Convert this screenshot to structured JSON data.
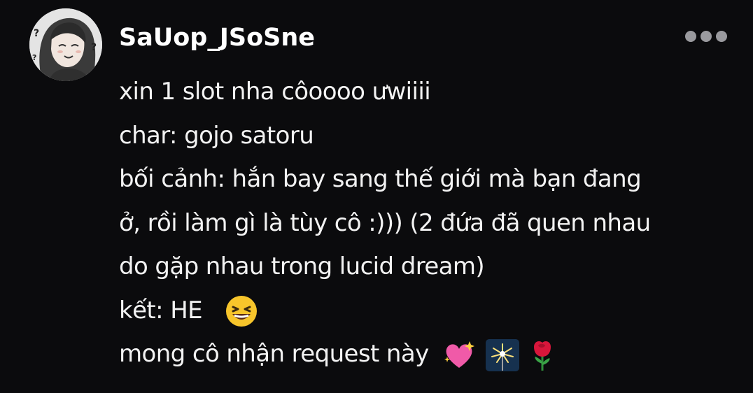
{
  "comment": {
    "username": "SaUop_JSoSne",
    "more_icon": "ellipsis-horizontal-icon",
    "avatar_icon": "user-avatar-drawing",
    "lines": [
      "xin 1 slot nha côoooo ưwiiii",
      "char: gojo satoru",
      "bối cảnh: hắn bay sang thế giới mà bạn đang",
      "ở, rồi làm gì là tùy cô :))) (2 đứa đã quen nhau",
      "do gặp nhau trong lucid dream)",
      "kết: HE",
      "mong cô nhận request này"
    ],
    "emojis": {
      "line6": "😆",
      "line7": [
        "💖",
        "🎇",
        "🌹"
      ]
    }
  },
  "colors": {
    "background": "#0b0b0d",
    "text": "#f2f2f2",
    "more_dots": "#9a9a9e"
  }
}
